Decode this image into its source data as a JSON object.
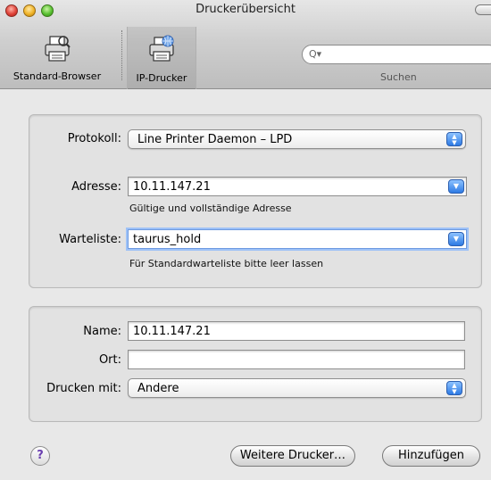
{
  "window": {
    "title": "Druckerübersicht"
  },
  "toolbar": {
    "items": [
      {
        "label": "Standard-Browser",
        "icon": "printer-icon"
      },
      {
        "label": "IP-Drucker",
        "icon": "network-printer-icon"
      }
    ],
    "search": {
      "label": "Suchen",
      "value": ""
    }
  },
  "connection": {
    "protocol_label": "Protokoll:",
    "protocol_value": "Line Printer Daemon – LPD",
    "address_label": "Adresse:",
    "address_value": "10.11.147.21",
    "address_hint": "Gültige und vollständige Adresse",
    "queue_label": "Warteliste:",
    "queue_value": "taurus_hold",
    "queue_hint": "Für Standardwarteliste bitte leer lassen"
  },
  "details": {
    "name_label": "Name:",
    "name_value": "10.11.147.21",
    "location_label": "Ort:",
    "location_value": "",
    "print_with_label": "Drucken mit:",
    "print_with_value": "Andere"
  },
  "buttons": {
    "help": "?",
    "more_printers": "Weitere Drucker…",
    "add": "Hinzufügen"
  }
}
